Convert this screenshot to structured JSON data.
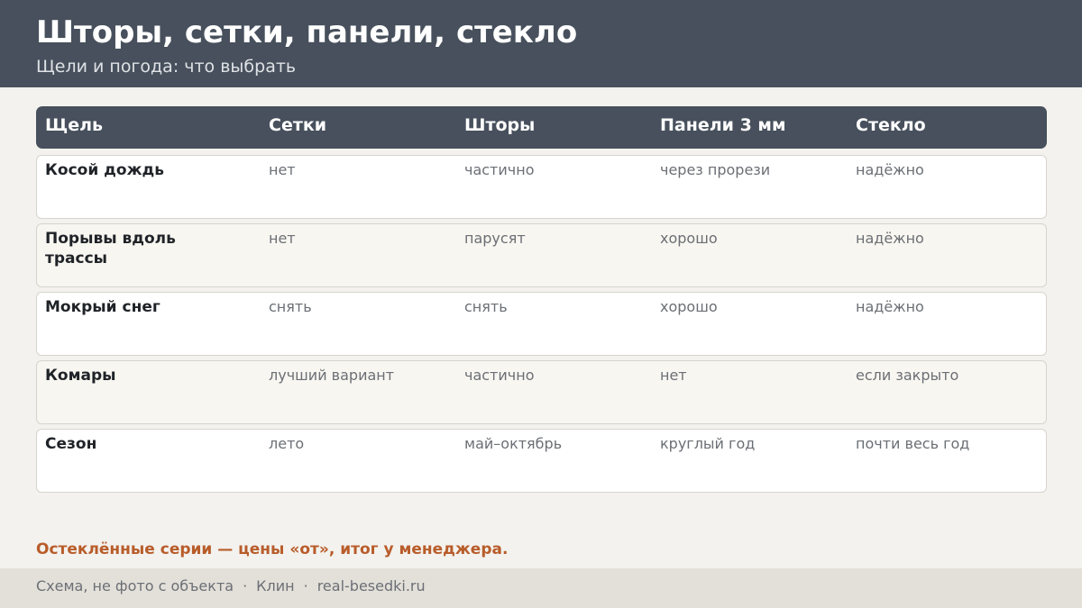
{
  "header": {
    "title": "Шторы, сетки, панели, стекло",
    "subtitle": "Щели и погода: что выбрать"
  },
  "table": {
    "columns": [
      "Щель",
      "Сетки",
      "Шторы",
      "Панели 3 мм",
      "Стекло"
    ],
    "rows": [
      {
        "label": "Косой дождь",
        "cells": [
          "нет",
          "частично",
          "через прорези",
          "надёжно"
        ]
      },
      {
        "label": "Порывы вдоль трассы",
        "cells": [
          "нет",
          "парусят",
          "хорошо",
          "надёжно"
        ]
      },
      {
        "label": "Мокрый снег",
        "cells": [
          "снять",
          "снять",
          "хорошо",
          "надёжно"
        ]
      },
      {
        "label": "Комары",
        "cells": [
          "лучший вариант",
          "частично",
          "нет",
          "если закрыто"
        ]
      },
      {
        "label": "Сезон",
        "cells": [
          "лето",
          "май–октябрь",
          "круглый год",
          "почти весь год"
        ]
      }
    ]
  },
  "note": "Остеклённые серии — цены «от», итог у менеджера.",
  "footer": {
    "parts": [
      "Схема, не фото с объекта",
      "Клин",
      "real-besedki.ru"
    ],
    "separator": "·"
  },
  "colors": {
    "header_bg": "#47505c",
    "accent": "#b85c2a",
    "page_bg": "#f3f2ee"
  }
}
